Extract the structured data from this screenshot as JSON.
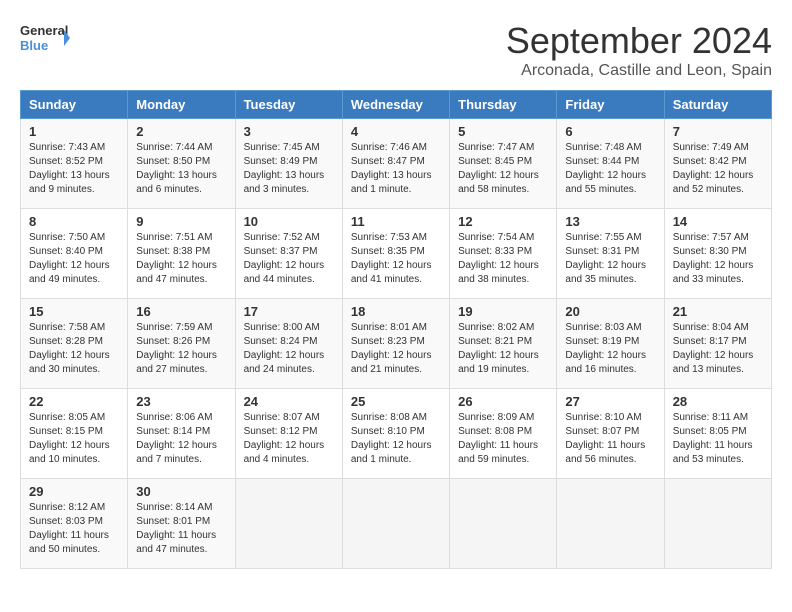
{
  "header": {
    "logo_line1": "General",
    "logo_line2": "Blue",
    "title": "September 2024",
    "subtitle": "Arconada, Castille and Leon, Spain"
  },
  "calendar": {
    "days_of_week": [
      "Sunday",
      "Monday",
      "Tuesday",
      "Wednesday",
      "Thursday",
      "Friday",
      "Saturday"
    ],
    "weeks": [
      [
        null,
        null,
        null,
        null,
        {
          "day": 1,
          "sunrise": "7:43 AM",
          "sunset": "8:52 PM",
          "daylight": "13 hours and 9 minutes."
        },
        {
          "day": 2,
          "sunrise": "7:44 AM",
          "sunset": "8:50 PM",
          "daylight": "13 hours and 6 minutes."
        },
        {
          "day": 3,
          "sunrise": "7:45 AM",
          "sunset": "8:49 PM",
          "daylight": "13 hours and 3 minutes."
        },
        {
          "day": 4,
          "sunrise": "7:46 AM",
          "sunset": "8:47 PM",
          "daylight": "13 hours and 1 minute."
        },
        {
          "day": 5,
          "sunrise": "7:47 AM",
          "sunset": "8:45 PM",
          "daylight": "12 hours and 58 minutes."
        },
        {
          "day": 6,
          "sunrise": "7:48 AM",
          "sunset": "8:44 PM",
          "daylight": "12 hours and 55 minutes."
        },
        {
          "day": 7,
          "sunrise": "7:49 AM",
          "sunset": "8:42 PM",
          "daylight": "12 hours and 52 minutes."
        }
      ],
      [
        {
          "day": 8,
          "sunrise": "7:50 AM",
          "sunset": "8:40 PM",
          "daylight": "12 hours and 49 minutes."
        },
        {
          "day": 9,
          "sunrise": "7:51 AM",
          "sunset": "8:38 PM",
          "daylight": "12 hours and 47 minutes."
        },
        {
          "day": 10,
          "sunrise": "7:52 AM",
          "sunset": "8:37 PM",
          "daylight": "12 hours and 44 minutes."
        },
        {
          "day": 11,
          "sunrise": "7:53 AM",
          "sunset": "8:35 PM",
          "daylight": "12 hours and 41 minutes."
        },
        {
          "day": 12,
          "sunrise": "7:54 AM",
          "sunset": "8:33 PM",
          "daylight": "12 hours and 38 minutes."
        },
        {
          "day": 13,
          "sunrise": "7:55 AM",
          "sunset": "8:31 PM",
          "daylight": "12 hours and 35 minutes."
        },
        {
          "day": 14,
          "sunrise": "7:57 AM",
          "sunset": "8:30 PM",
          "daylight": "12 hours and 33 minutes."
        }
      ],
      [
        {
          "day": 15,
          "sunrise": "7:58 AM",
          "sunset": "8:28 PM",
          "daylight": "12 hours and 30 minutes."
        },
        {
          "day": 16,
          "sunrise": "7:59 AM",
          "sunset": "8:26 PM",
          "daylight": "12 hours and 27 minutes."
        },
        {
          "day": 17,
          "sunrise": "8:00 AM",
          "sunset": "8:24 PM",
          "daylight": "12 hours and 24 minutes."
        },
        {
          "day": 18,
          "sunrise": "8:01 AM",
          "sunset": "8:23 PM",
          "daylight": "12 hours and 21 minutes."
        },
        {
          "day": 19,
          "sunrise": "8:02 AM",
          "sunset": "8:21 PM",
          "daylight": "12 hours and 19 minutes."
        },
        {
          "day": 20,
          "sunrise": "8:03 AM",
          "sunset": "8:19 PM",
          "daylight": "12 hours and 16 minutes."
        },
        {
          "day": 21,
          "sunrise": "8:04 AM",
          "sunset": "8:17 PM",
          "daylight": "12 hours and 13 minutes."
        }
      ],
      [
        {
          "day": 22,
          "sunrise": "8:05 AM",
          "sunset": "8:15 PM",
          "daylight": "12 hours and 10 minutes."
        },
        {
          "day": 23,
          "sunrise": "8:06 AM",
          "sunset": "8:14 PM",
          "daylight": "12 hours and 7 minutes."
        },
        {
          "day": 24,
          "sunrise": "8:07 AM",
          "sunset": "8:12 PM",
          "daylight": "12 hours and 4 minutes."
        },
        {
          "day": 25,
          "sunrise": "8:08 AM",
          "sunset": "8:10 PM",
          "daylight": "12 hours and 1 minute."
        },
        {
          "day": 26,
          "sunrise": "8:09 AM",
          "sunset": "8:08 PM",
          "daylight": "11 hours and 59 minutes."
        },
        {
          "day": 27,
          "sunrise": "8:10 AM",
          "sunset": "8:07 PM",
          "daylight": "11 hours and 56 minutes."
        },
        {
          "day": 28,
          "sunrise": "8:11 AM",
          "sunset": "8:05 PM",
          "daylight": "11 hours and 53 minutes."
        }
      ],
      [
        {
          "day": 29,
          "sunrise": "8:12 AM",
          "sunset": "8:03 PM",
          "daylight": "11 hours and 50 minutes."
        },
        {
          "day": 30,
          "sunrise": "8:14 AM",
          "sunset": "8:01 PM",
          "daylight": "11 hours and 47 minutes."
        },
        null,
        null,
        null,
        null,
        null
      ]
    ],
    "labels": {
      "sunrise": "Sunrise:",
      "sunset": "Sunset:",
      "daylight": "Daylight:"
    }
  }
}
